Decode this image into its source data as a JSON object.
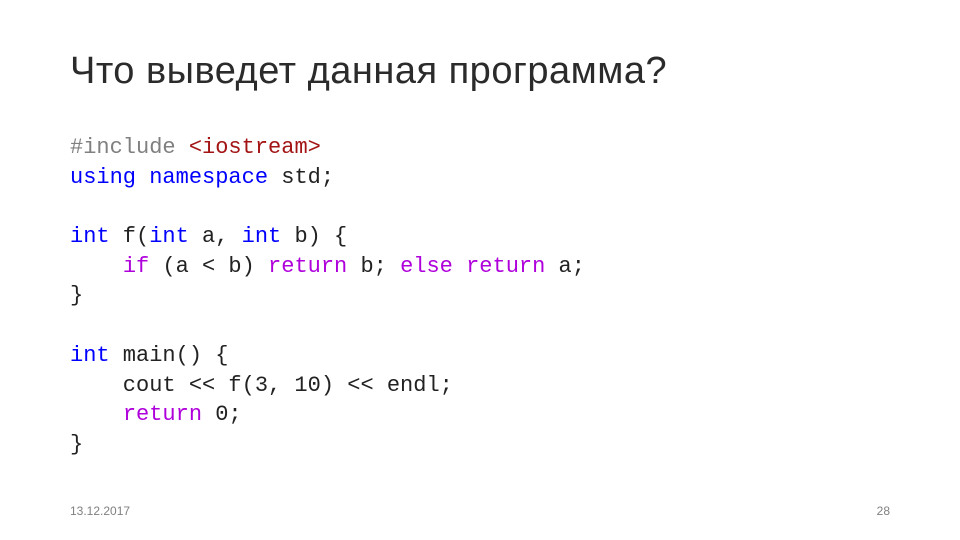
{
  "title": "Что выведет данная программа?",
  "code": {
    "l1a": "#include",
    "l1b": " <iostream>",
    "l2a": "using",
    "l2b": " ",
    "l2c": "namespace",
    "l2d": " std;",
    "l3": "",
    "l4a": "int",
    "l4b": " f(",
    "l4c": "int",
    "l4d": " a, ",
    "l4e": "int",
    "l4f": " b) {",
    "l5a": "    ",
    "l5b": "if",
    "l5c": " (a < b) ",
    "l5d": "return",
    "l5e": " b; ",
    "l5f": "else",
    "l5g": " ",
    "l5h": "return",
    "l5i": " a;",
    "l6": "}",
    "l7": "",
    "l8a": "int",
    "l8b": " main() {",
    "l9a": "    cout << f(3, 10) << endl;",
    "l10a": "    ",
    "l10b": "return",
    "l10c": " 0;",
    "l11": "}"
  },
  "footer": {
    "date": "13.12.2017",
    "page": "28"
  }
}
